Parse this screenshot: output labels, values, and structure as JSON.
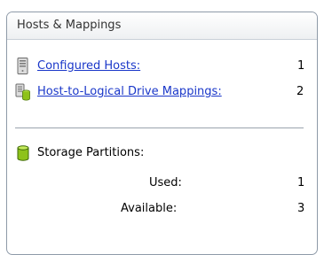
{
  "panel": {
    "title": "Hosts & Mappings"
  },
  "configured_hosts": {
    "label": "Configured Hosts:",
    "value": "1",
    "icon": "server-host-icon"
  },
  "host_mappings": {
    "label": "Host-to-Logical Drive Mappings:",
    "value": "2",
    "icon": "host-mapping-icon"
  },
  "storage_partitions": {
    "label": "Storage Partitions:",
    "icon": "storage-cylinder-icon",
    "used_label": "Used:",
    "used_value": "1",
    "available_label": "Available:",
    "available_value": "3"
  },
  "colors": {
    "link": "#1a37c9",
    "cylinder": "#8ec21a",
    "border": "#8e9aa8"
  }
}
